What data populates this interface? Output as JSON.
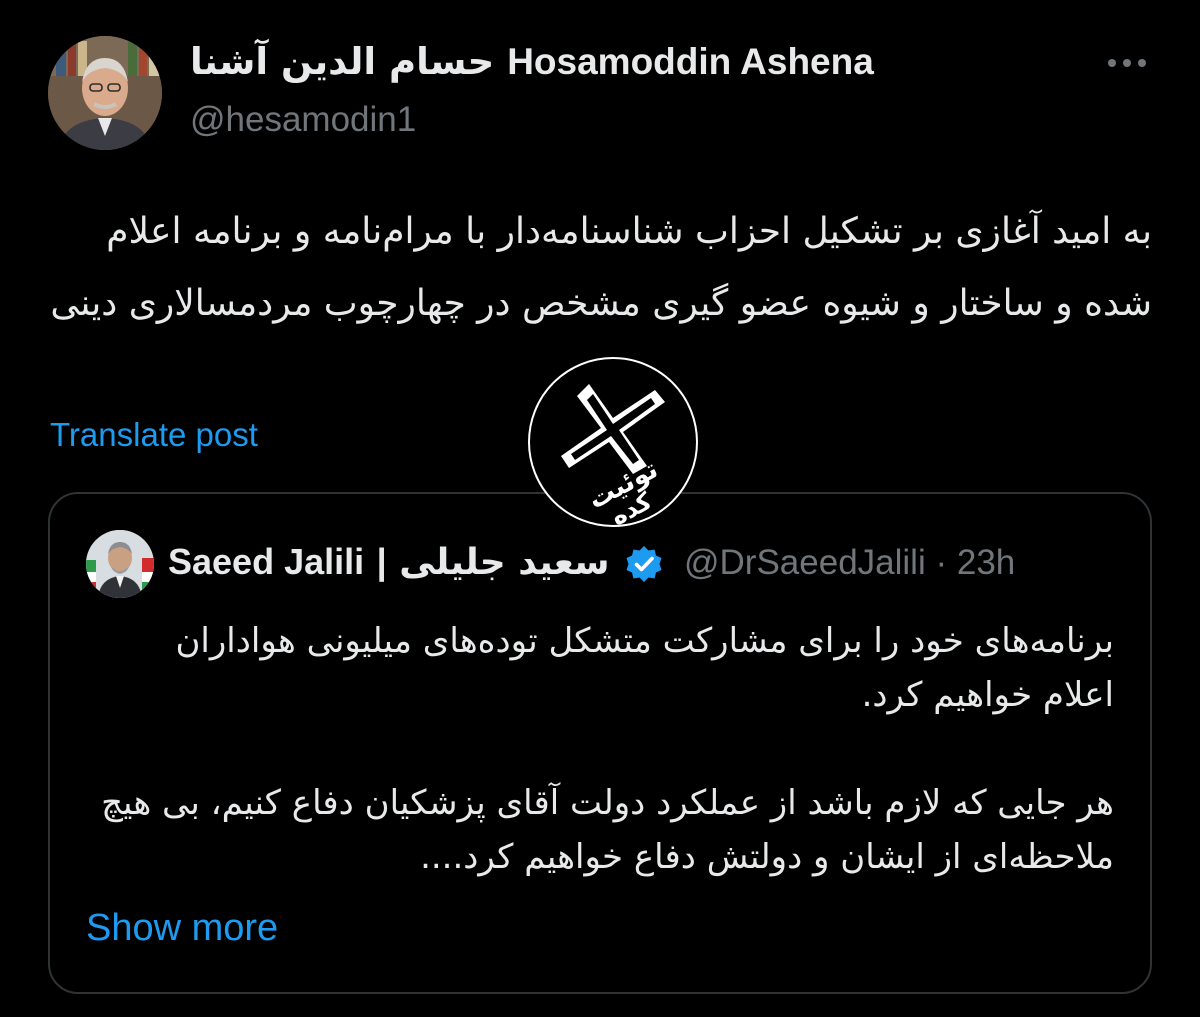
{
  "author": {
    "display_name_latin": "Hosamoddin Ashena",
    "display_name_persian": "حسام الدین آشنا",
    "handle": "@hesamodin1"
  },
  "more_icon": "more-horizontal-icon",
  "post": {
    "text": "به امید آغازی بر تشکیل احزاب شناسنامه‌دار با مرام‌نامه و برنامه اعلام شده و ساختار و شیوه عضو گیری مشخص در چهارچوب مردمسالاری دینی"
  },
  "translate_label": "Translate post",
  "watermark": {
    "text_line1": "توئیت",
    "text_line2": "کده"
  },
  "quote": {
    "display_name_latin": "Saeed Jalili",
    "separator": "|",
    "display_name_persian": "سعید جلیلی",
    "handle": "@DrSaeedJalili",
    "time_separator": "·",
    "time": "23h",
    "verified_icon": "verified-badge-icon",
    "paragraph1": "برنامه‌های خود را برای مشارکت متشکل توده‌های میلیونی هواداران اعلام خواهیم کرد.",
    "paragraph2": "هر جایی که لازم باشد از عملکرد دولت آقای پزشکیان دفاع کنیم، بی هیچ ملاحظه‌ای از ایشان و دولتش دفاع خواهیم کرد....",
    "show_more_label": "Show more"
  },
  "colors": {
    "background": "#000000",
    "primary_text": "#e7e9ea",
    "secondary_text": "#71767b",
    "link": "#1d9bf0",
    "border": "#2f3336"
  }
}
